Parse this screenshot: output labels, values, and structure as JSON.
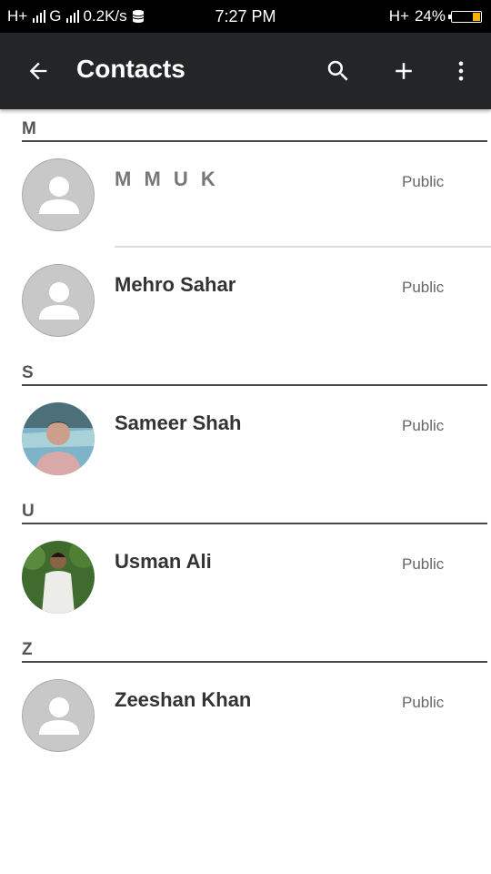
{
  "status_bar": {
    "network_left": "H+",
    "network_g": "G",
    "speed": "0.2K/s",
    "time": "7:27 PM",
    "network_right": "H+",
    "battery": "24%"
  },
  "app_bar": {
    "title": "Contacts",
    "icons": [
      "back-arrow-icon",
      "search-icon",
      "add-icon",
      "more-vert-icon"
    ]
  },
  "sections": [
    {
      "letter": "M",
      "contacts": [
        {
          "name": "M M U K",
          "visibility": "Public",
          "avatar": "placeholder"
        },
        {
          "name": "Mehro Sahar",
          "visibility": "Public",
          "avatar": "placeholder"
        }
      ]
    },
    {
      "letter": "S",
      "contacts": [
        {
          "name": "Sameer Shah",
          "visibility": "Public",
          "avatar": "photo"
        }
      ]
    },
    {
      "letter": "U",
      "contacts": [
        {
          "name": "Usman Ali",
          "visibility": "Public",
          "avatar": "photo"
        }
      ]
    },
    {
      "letter": "Z",
      "contacts": [
        {
          "name": "Zeeshan Khan",
          "visibility": "Public",
          "avatar": "placeholder"
        }
      ]
    }
  ],
  "colors": {
    "app_bar": "#232527",
    "status_bar": "#000000",
    "avatar_placeholder": "#c8c8c8",
    "battery_fill": "#f3b400"
  }
}
